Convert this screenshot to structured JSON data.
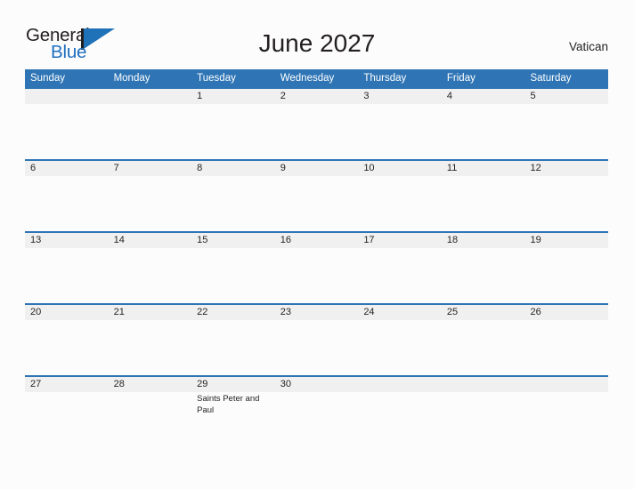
{
  "brand": {
    "name_part1": "General",
    "name_part2": "Blue",
    "flag_icon": "flag-icon"
  },
  "header": {
    "title": "June 2027",
    "region": "Vatican"
  },
  "calendar": {
    "month": "June",
    "year": "2027",
    "weekdays": [
      "Sunday",
      "Monday",
      "Tuesday",
      "Wednesday",
      "Thursday",
      "Friday",
      "Saturday"
    ],
    "colors": {
      "header_blue": "#2f75b5",
      "date_band_gray": "#f0f0f0",
      "page_background": "#fcfcfc",
      "text_dark": "#231f20",
      "brand_blue": "#1f6fc0"
    },
    "weeks": [
      [
        {
          "date": "",
          "event": ""
        },
        {
          "date": "",
          "event": ""
        },
        {
          "date": "1",
          "event": ""
        },
        {
          "date": "2",
          "event": ""
        },
        {
          "date": "3",
          "event": ""
        },
        {
          "date": "4",
          "event": ""
        },
        {
          "date": "5",
          "event": ""
        }
      ],
      [
        {
          "date": "6",
          "event": ""
        },
        {
          "date": "7",
          "event": ""
        },
        {
          "date": "8",
          "event": ""
        },
        {
          "date": "9",
          "event": ""
        },
        {
          "date": "10",
          "event": ""
        },
        {
          "date": "11",
          "event": ""
        },
        {
          "date": "12",
          "event": ""
        }
      ],
      [
        {
          "date": "13",
          "event": ""
        },
        {
          "date": "14",
          "event": ""
        },
        {
          "date": "15",
          "event": ""
        },
        {
          "date": "16",
          "event": ""
        },
        {
          "date": "17",
          "event": ""
        },
        {
          "date": "18",
          "event": ""
        },
        {
          "date": "19",
          "event": ""
        }
      ],
      [
        {
          "date": "20",
          "event": ""
        },
        {
          "date": "21",
          "event": ""
        },
        {
          "date": "22",
          "event": ""
        },
        {
          "date": "23",
          "event": ""
        },
        {
          "date": "24",
          "event": ""
        },
        {
          "date": "25",
          "event": ""
        },
        {
          "date": "26",
          "event": ""
        }
      ],
      [
        {
          "date": "27",
          "event": ""
        },
        {
          "date": "28",
          "event": ""
        },
        {
          "date": "29",
          "event": "Saints Peter and Paul"
        },
        {
          "date": "30",
          "event": ""
        },
        {
          "date": "",
          "event": ""
        },
        {
          "date": "",
          "event": ""
        },
        {
          "date": "",
          "event": ""
        }
      ]
    ]
  }
}
